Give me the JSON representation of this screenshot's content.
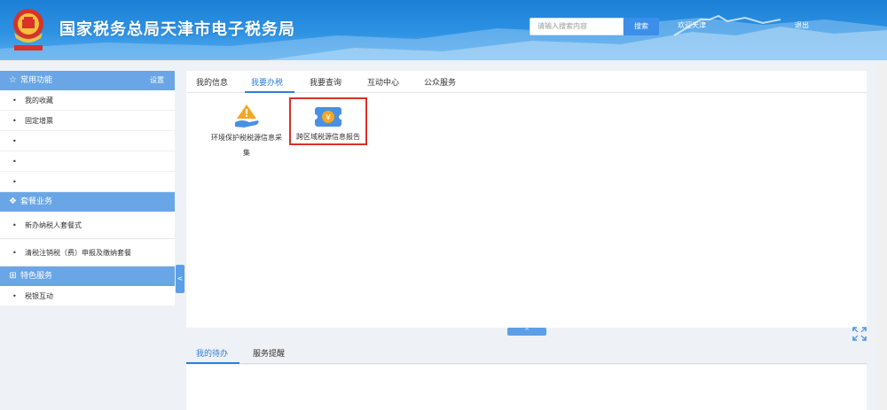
{
  "header": {
    "site_title": "国家税务总局天津市电子税务局",
    "search_placeholder": "请输入搜索内容",
    "search_button": "搜索",
    "welcome_text": "欢迎天津",
    "logout": "退出",
    "colors": {
      "header_blue": "#1b7fd6",
      "accent": "#2e7fd6",
      "section_head": "#6aa6e6",
      "highlight_border": "#d9302c"
    }
  },
  "sidebar": {
    "common": {
      "title": "常用功能",
      "icon": "star-icon",
      "settings": "设置",
      "items": [
        "我的收藏",
        "固定增票",
        "",
        "",
        ""
      ]
    },
    "package": {
      "title": "套餐业务",
      "icon": "layers-icon",
      "items": [
        "新办纳税人套餐式",
        "清税注销税（费）申报及缴纳套餐"
      ]
    },
    "special": {
      "title": "特色服务",
      "icon": "grid-icon",
      "items": [
        "税银互动"
      ]
    },
    "collapse_arrow": "<"
  },
  "main": {
    "tabs": [
      "我的信息",
      "我要办税",
      "我要查询",
      "互动中心",
      "公众服务"
    ],
    "active_tab": "我要办税",
    "tiles": [
      {
        "label_line1": "环境保护税税源信息采",
        "label_line2": "集",
        "icon": "warning-hand-icon"
      },
      {
        "label_line1": "跨区域税源信息报告",
        "icon": "yuan-ticket-icon",
        "highlighted": true
      }
    ],
    "collapse_up": "^"
  },
  "bottom": {
    "tabs": [
      "我的待办",
      "服务提醒"
    ],
    "active_tab": "我的待办"
  }
}
